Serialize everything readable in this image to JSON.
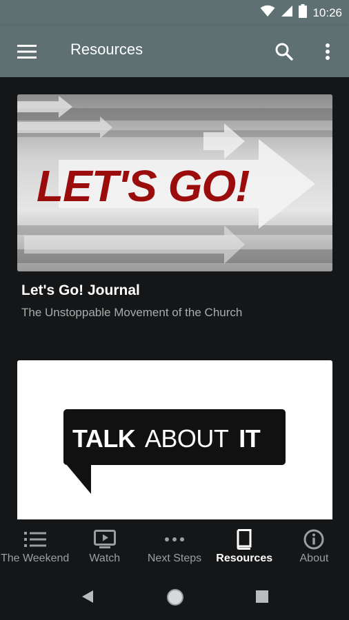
{
  "status_bar": {
    "time": "10:26",
    "icons": [
      "wifi-icon",
      "signal-icon",
      "battery-icon"
    ]
  },
  "app_bar": {
    "title": "Resources",
    "icons": [
      "menu-icon",
      "search-icon",
      "more-vert-icon"
    ]
  },
  "cards": [
    {
      "banner_text": "LET'S GO!",
      "title": "Let's Go! Journal",
      "subtitle": "The Unstoppable Movement of the Church"
    },
    {
      "banner_text_bold_1": "TALK",
      "banner_text_light": "ABOUT",
      "banner_text_bold_2": "IT"
    }
  ],
  "bottom_nav": {
    "items": [
      {
        "label": "The Weekend",
        "icon": "list-icon",
        "active": false
      },
      {
        "label": "Watch",
        "icon": "tv-play-icon",
        "active": false
      },
      {
        "label": "Next Steps",
        "icon": "dots-icon",
        "active": false
      },
      {
        "label": "Resources",
        "icon": "book-icon",
        "active": true
      },
      {
        "label": "About",
        "icon": "info-icon",
        "active": false
      }
    ]
  },
  "system_nav": {
    "icons": [
      "back-icon",
      "home-icon",
      "recents-icon"
    ]
  },
  "colors": {
    "app_bar": "#5e7071",
    "background": "#151617",
    "banner_red": "#9b0c0c",
    "nav_inactive": "#9c9fa0",
    "nav_active": "#ffffff"
  }
}
